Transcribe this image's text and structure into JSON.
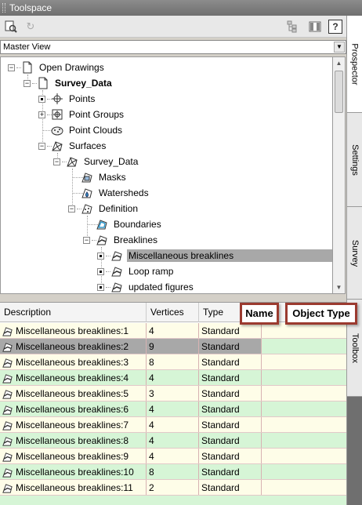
{
  "window": {
    "title": "Toolspace"
  },
  "view_selector": {
    "value": "Master View"
  },
  "tree": [
    {
      "label": "Open Drawings",
      "icon": "open-drawings-icon"
    },
    {
      "label": "Survey_Data",
      "icon": "drawing-icon"
    },
    {
      "label": "Points",
      "icon": "points-icon"
    },
    {
      "label": "Point Groups",
      "icon": "point-groups-icon"
    },
    {
      "label": "Point Clouds",
      "icon": "point-clouds-icon"
    },
    {
      "label": "Surfaces",
      "icon": "surfaces-icon"
    },
    {
      "label": "Survey_Data",
      "icon": "surface-icon"
    },
    {
      "label": "Masks",
      "icon": "masks-icon"
    },
    {
      "label": "Watersheds",
      "icon": "watersheds-icon"
    },
    {
      "label": "Definition",
      "icon": "definition-icon"
    },
    {
      "label": "Boundaries",
      "icon": "boundaries-icon"
    },
    {
      "label": "Breaklines",
      "icon": "breaklines-icon"
    },
    {
      "label": "Miscellaneous breaklines",
      "icon": "breakline-icon"
    },
    {
      "label": "Loop ramp",
      "icon": "breakline-icon"
    },
    {
      "label": "updated figures",
      "icon": "breakline-icon"
    }
  ],
  "side_tabs": [
    "Prospector",
    "Settings",
    "Survey",
    "Toolbox"
  ],
  "table": {
    "headers": {
      "description": "Description",
      "vertices": "Vertices",
      "type": "Type"
    },
    "rows": [
      {
        "description": "Miscellaneous breaklines:1",
        "vertices": "4",
        "type": "Standard"
      },
      {
        "description": "Miscellaneous breaklines:2",
        "vertices": "9",
        "type": "Standard"
      },
      {
        "description": "Miscellaneous breaklines:3",
        "vertices": "8",
        "type": "Standard"
      },
      {
        "description": "Miscellaneous breaklines:4",
        "vertices": "4",
        "type": "Standard"
      },
      {
        "description": "Miscellaneous breaklines:5",
        "vertices": "3",
        "type": "Standard"
      },
      {
        "description": "Miscellaneous breaklines:6",
        "vertices": "4",
        "type": "Standard"
      },
      {
        "description": "Miscellaneous breaklines:7",
        "vertices": "4",
        "type": "Standard"
      },
      {
        "description": "Miscellaneous breaklines:8",
        "vertices": "4",
        "type": "Standard"
      },
      {
        "description": "Miscellaneous breaklines:9",
        "vertices": "4",
        "type": "Standard"
      },
      {
        "description": "Miscellaneous breaklines:10",
        "vertices": "8",
        "type": "Standard"
      },
      {
        "description": "Miscellaneous breaklines:11",
        "vertices": "2",
        "type": "Standard"
      }
    ]
  },
  "callouts": {
    "name": "Name",
    "object_type": "Object Type"
  },
  "colors": {
    "callout_border": "#9b3a2f",
    "row_odd": "#fefde8",
    "row_even": "#d6f5d6",
    "selection": "#a8a8a8"
  }
}
